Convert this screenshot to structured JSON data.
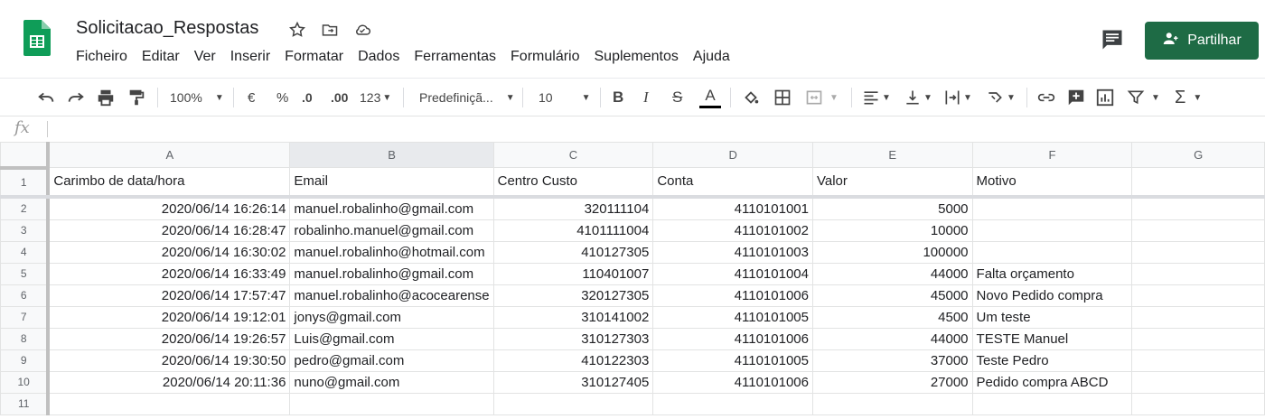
{
  "doc": {
    "title": "Solicitacao_Respostas"
  },
  "menu": [
    "Ficheiro",
    "Editar",
    "Ver",
    "Inserir",
    "Formatar",
    "Dados",
    "Ferramentas",
    "Formulário",
    "Suplementos",
    "Ajuda"
  ],
  "share": {
    "label": "Partilhar"
  },
  "toolbar": {
    "zoom": "100%",
    "currency": "€",
    "percent": "%",
    "dec_less": ".0",
    "dec_more": ".00",
    "more_formats": "123",
    "font": "Predefiniçã...",
    "font_size": "10"
  },
  "formula": {
    "fx": "fx"
  },
  "columns": [
    "A",
    "B",
    "C",
    "D",
    "E",
    "F",
    "G"
  ],
  "header_row": {
    "num": "1",
    "cells": [
      "Carimbo de data/hora",
      "Email",
      "Centro Custo",
      "Conta",
      "Valor",
      "Motivo",
      ""
    ]
  },
  "rows": [
    {
      "num": "2",
      "cells": [
        "2020/06/14 16:26:14",
        "manuel.robalinho@gmail.com",
        "320111104",
        "4110101001",
        "5000",
        "",
        ""
      ]
    },
    {
      "num": "3",
      "cells": [
        "2020/06/14 16:28:47",
        "robalinho.manuel@gmail.com",
        "4101111004",
        "4110101002",
        "10000",
        "",
        ""
      ]
    },
    {
      "num": "4",
      "cells": [
        "2020/06/14 16:30:02",
        "manuel.robalinho@hotmail.com",
        "410127305",
        "4110101003",
        "100000",
        "",
        ""
      ]
    },
    {
      "num": "5",
      "cells": [
        "2020/06/14 16:33:49",
        "manuel.robalinho@gmail.com",
        "110401007",
        "4110101004",
        "44000",
        "Falta orçamento",
        ""
      ]
    },
    {
      "num": "6",
      "cells": [
        "2020/06/14 17:57:47",
        "manuel.robalinho@acocearense",
        "320127305",
        "4110101006",
        "45000",
        "Novo Pedido compra",
        ""
      ]
    },
    {
      "num": "7",
      "cells": [
        "2020/06/14 19:12:01",
        "jonys@gmail.com",
        "310141002",
        "4110101005",
        "4500",
        "Um teste",
        ""
      ]
    },
    {
      "num": "8",
      "cells": [
        "2020/06/14 19:26:57",
        "Luis@gmail.com",
        "310127303",
        "4110101006",
        "44000",
        "TESTE Manuel",
        ""
      ]
    },
    {
      "num": "9",
      "cells": [
        "2020/06/14 19:30:50",
        "pedro@gmail.com",
        "410122303",
        "4110101005",
        "37000",
        "Teste Pedro",
        ""
      ]
    },
    {
      "num": "10",
      "cells": [
        "2020/06/14 20:11:36",
        "nuno@gmail.com",
        "310127405",
        "4110101006",
        "27000",
        "Pedido compra ABCD",
        ""
      ]
    },
    {
      "num": "11",
      "cells": [
        "",
        "",
        "",
        "",
        "",
        "",
        ""
      ]
    }
  ],
  "colors": {
    "share_bg": "#1e6b45",
    "sheets_green": "#0f9d58"
  }
}
